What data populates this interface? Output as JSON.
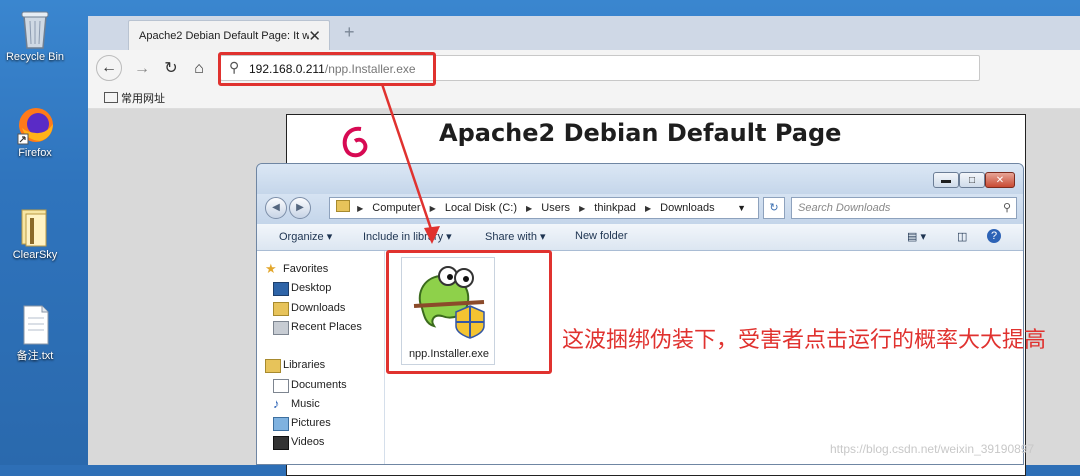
{
  "desktop": {
    "icons": [
      {
        "label": "Recycle Bin"
      },
      {
        "label": "Firefox"
      },
      {
        "label": "ClearSky"
      },
      {
        "label": "备注.txt"
      }
    ]
  },
  "browser": {
    "tab_title": "Apache2 Debian Default Page: It wo",
    "tab_close": "✕",
    "new_tab": "+",
    "url_host": "192.168.0.211",
    "url_path": "/npp.Installer.exe",
    "bookmark_label": "常用网址",
    "page_heading": "Apache2 Debian Default Page"
  },
  "explorer": {
    "breadcrumb": [
      "Computer",
      "Local Disk (C:)",
      "Users",
      "thinkpad",
      "Downloads"
    ],
    "search_placeholder": "Search Downloads",
    "toolbar": {
      "organize": "Organize ▾",
      "include": "Include in library ▾",
      "share": "Share with ▾",
      "new_folder": "New folder"
    },
    "nav": {
      "favorites": "Favorites",
      "desktop": "Desktop",
      "downloads": "Downloads",
      "recent": "Recent Places",
      "libraries": "Libraries",
      "documents": "Documents",
      "music": "Music",
      "pictures": "Pictures",
      "videos": "Videos"
    },
    "file_name": "npp.Installer.exe"
  },
  "annotation": "这波捆绑伪装下，受害者点击运行的概率大大提高",
  "watermark": "https://blog.csdn.net/weixin_39190897",
  "colors": {
    "accent_red": "#e0322f",
    "desktop_blue": "#2f74bd"
  }
}
